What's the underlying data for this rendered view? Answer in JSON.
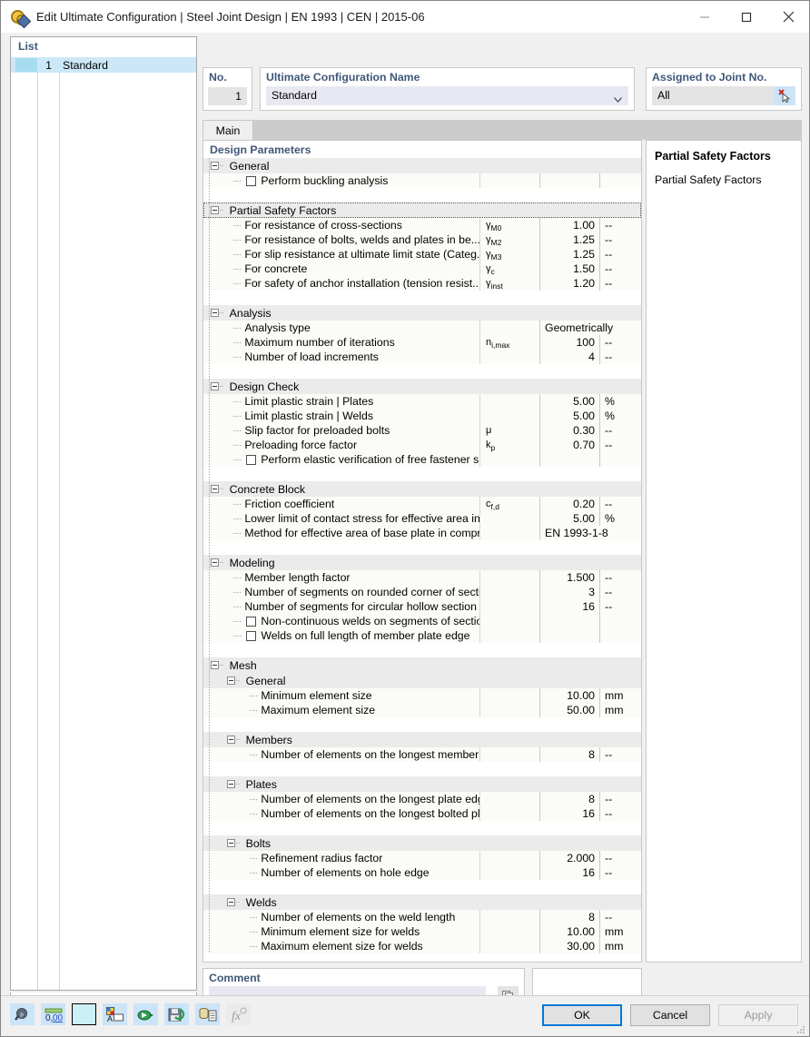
{
  "window": {
    "title": "Edit Ultimate Configuration | Steel Joint Design | EN 1993 | CEN | 2015-06",
    "icon": "joint-config-icon",
    "minimize": "minimize-icon",
    "maximize": "maximize-icon",
    "close": "close-icon"
  },
  "list": {
    "header": "List",
    "rows": [
      {
        "no": "1",
        "name": "Standard"
      }
    ],
    "toolbar": [
      {
        "name": "new-configuration-button",
        "enabled": true
      },
      {
        "name": "copy-configuration-button",
        "enabled": true
      },
      {
        "name": "select-all-button",
        "enabled": false
      },
      {
        "name": "deselect-all-button",
        "enabled": false
      },
      {
        "name": "delete-configuration-button",
        "enabled": true
      }
    ]
  },
  "header": {
    "no_label": "No.",
    "no_value": "1",
    "name_label": "Ultimate Configuration Name",
    "name_value": "Standard",
    "joint_label": "Assigned to Joint No.",
    "joint_value": "All",
    "joint_pick_icon": "pick-joint-icon"
  },
  "tabs": [
    {
      "label": "Main",
      "active": true
    }
  ],
  "main": {
    "title": "Design Parameters",
    "sections": [
      {
        "name": "General",
        "selected": false,
        "rows": [
          {
            "type": "check",
            "label": "Perform buckling analysis",
            "checked": false,
            "sym": "",
            "val": "",
            "unit": ""
          }
        ]
      },
      {
        "name": "Partial Safety Factors",
        "selected": true,
        "rows": [
          {
            "type": "value",
            "label": "For resistance of cross-sections",
            "sym": "γM0",
            "sym_base": "γ",
            "sym_sub": "M0",
            "val": "1.00",
            "unit": "--"
          },
          {
            "type": "value",
            "label": "For resistance of bolts, welds and plates in be...",
            "sym_base": "γ",
            "sym_sub": "M2",
            "val": "1.25",
            "unit": "--"
          },
          {
            "type": "value",
            "label": "For slip resistance at ultimate limit state (Categ...",
            "sym_base": "γ",
            "sym_sub": "M3",
            "val": "1.25",
            "unit": "--"
          },
          {
            "type": "value",
            "label": "For concrete",
            "sym_base": "γ",
            "sym_sub": "c",
            "val": "1.50",
            "unit": "--"
          },
          {
            "type": "value",
            "label": "For safety of anchor installation (tension resist...",
            "sym_base": "γ",
            "sym_sub": "inst",
            "val": "1.20",
            "unit": "--"
          }
        ]
      },
      {
        "name": "Analysis",
        "selected": false,
        "rows": [
          {
            "type": "wide",
            "label": "Analysis type",
            "sym_base": "",
            "sym_sub": "",
            "val": "Geometrically linear",
            "unit": ""
          },
          {
            "type": "value",
            "label": "Maximum number of iterations",
            "sym_base": "n",
            "sym_sub": "i,max",
            "val": "100",
            "unit": "--"
          },
          {
            "type": "value",
            "label": "Number of load increments",
            "sym_base": "",
            "sym_sub": "",
            "val": "4",
            "unit": "--"
          }
        ]
      },
      {
        "name": "Design Check",
        "selected": false,
        "rows": [
          {
            "type": "value",
            "label": "Limit plastic strain | Plates",
            "sym_base": "",
            "sym_sub": "",
            "val": "5.00",
            "unit": "%"
          },
          {
            "type": "value",
            "label": "Limit plastic strain | Welds",
            "sym_base": "",
            "sym_sub": "",
            "val": "5.00",
            "unit": "%"
          },
          {
            "type": "value",
            "label": "Slip factor for preloaded bolts",
            "sym_base": "μ",
            "sym_sub": "",
            "val": "0.30",
            "unit": "--"
          },
          {
            "type": "value",
            "label": "Preloading force factor",
            "sym_base": "k",
            "sym_sub": "p",
            "val": "0.70",
            "unit": "--"
          },
          {
            "type": "check",
            "label": "Perform elastic verification of free fastener shank",
            "checked": false,
            "sym_base": "",
            "sym_sub": "",
            "val": "",
            "unit": ""
          }
        ]
      },
      {
        "name": "Concrete Block",
        "selected": false,
        "rows": [
          {
            "type": "value",
            "label": "Friction coefficient",
            "sym_base": "c",
            "sym_sub": "f,d",
            "val": "0.20",
            "unit": "--"
          },
          {
            "type": "value",
            "label": "Lower limit of contact stress for effective area in compression",
            "sym_base": "",
            "sym_sub": "",
            "val": "5.00",
            "unit": "%"
          },
          {
            "type": "wide",
            "label": "Method for effective area of base plate in compression",
            "sym_base": "",
            "sym_sub": "",
            "val": "EN 1993-1-8",
            "unit": ""
          }
        ]
      },
      {
        "name": "Modeling",
        "selected": false,
        "rows": [
          {
            "type": "value",
            "label": "Member length factor",
            "sym_base": "",
            "sym_sub": "",
            "val": "1.500",
            "unit": "--"
          },
          {
            "type": "value",
            "label": "Number of segments on rounded corner of section",
            "sym_base": "",
            "sym_sub": "",
            "val": "3",
            "unit": "--"
          },
          {
            "type": "value",
            "label": "Number of segments for circular hollow section",
            "sym_base": "",
            "sym_sub": "",
            "val": "16",
            "unit": "--"
          },
          {
            "type": "check",
            "label": "Non-continuous welds on segments of sections",
            "checked": false,
            "sym_base": "",
            "sym_sub": "",
            "val": "",
            "unit": ""
          },
          {
            "type": "check",
            "label": "Welds on full length of member plate edge",
            "checked": false,
            "sym_base": "",
            "sym_sub": "",
            "val": "",
            "unit": ""
          }
        ]
      },
      {
        "name": "Mesh",
        "selected": false,
        "rows": [],
        "subsections": [
          {
            "name": "General",
            "rows": [
              {
                "type": "value",
                "label": "Minimum element size",
                "sym_base": "",
                "sym_sub": "",
                "val": "10.00",
                "unit": "mm"
              },
              {
                "type": "value",
                "label": "Maximum element size",
                "sym_base": "",
                "sym_sub": "",
                "val": "50.00",
                "unit": "mm"
              }
            ]
          },
          {
            "name": "Members",
            "rows": [
              {
                "type": "value",
                "label": "Number of elements on the longest member section edge",
                "sym_base": "",
                "sym_sub": "",
                "val": "8",
                "unit": "--"
              }
            ]
          },
          {
            "name": "Plates",
            "rows": [
              {
                "type": "value",
                "label": "Number of elements on the longest plate edge",
                "sym_base": "",
                "sym_sub": "",
                "val": "8",
                "unit": "--"
              },
              {
                "type": "value",
                "label": "Number of elements on the longest bolted plate edge",
                "sym_base": "",
                "sym_sub": "",
                "val": "16",
                "unit": "--"
              }
            ]
          },
          {
            "name": "Bolts",
            "rows": [
              {
                "type": "value",
                "label": "Refinement radius factor",
                "sym_base": "",
                "sym_sub": "",
                "val": "2.000",
                "unit": "--"
              },
              {
                "type": "value",
                "label": "Number of elements on hole edge",
                "sym_base": "",
                "sym_sub": "",
                "val": "16",
                "unit": "--"
              }
            ]
          },
          {
            "name": "Welds",
            "rows": [
              {
                "type": "value",
                "label": "Number of elements on the weld length",
                "sym_base": "",
                "sym_sub": "",
                "val": "8",
                "unit": "--"
              },
              {
                "type": "value",
                "label": "Minimum element size for welds",
                "sym_base": "",
                "sym_sub": "",
                "val": "10.00",
                "unit": "mm"
              },
              {
                "type": "value",
                "label": "Maximum element size for welds",
                "sym_base": "",
                "sym_sub": "",
                "val": "30.00",
                "unit": "mm"
              }
            ]
          }
        ]
      }
    ]
  },
  "info": {
    "title": "Partial Safety Factors",
    "text": "Partial Safety Factors"
  },
  "comment": {
    "label": "Comment",
    "value": "",
    "placeholder": "",
    "button_icon": "copy-comment-icon"
  },
  "bottom_toolbar": [
    {
      "name": "search-magnifier-icon",
      "enabled": true
    },
    {
      "name": "units-decimal-places-icon",
      "enabled": true
    },
    {
      "name": "color-swatch-icon",
      "enabled": true
    },
    {
      "name": "display-properties-icon",
      "enabled": true
    },
    {
      "name": "import-config-icon",
      "enabled": true
    },
    {
      "name": "save-config-icon",
      "enabled": true
    },
    {
      "name": "database-export-icon",
      "enabled": true
    },
    {
      "name": "formula-icon",
      "enabled": false
    }
  ],
  "dialog_buttons": {
    "ok": "OK",
    "cancel": "Cancel",
    "apply": "Apply"
  },
  "colors": {
    "label_blue": "#3f5878",
    "selection_blue": "#cce8f8",
    "accent_blue": "#0078d7",
    "group_gray": "#ebebeb",
    "row_alt": "#fbfbf7"
  }
}
